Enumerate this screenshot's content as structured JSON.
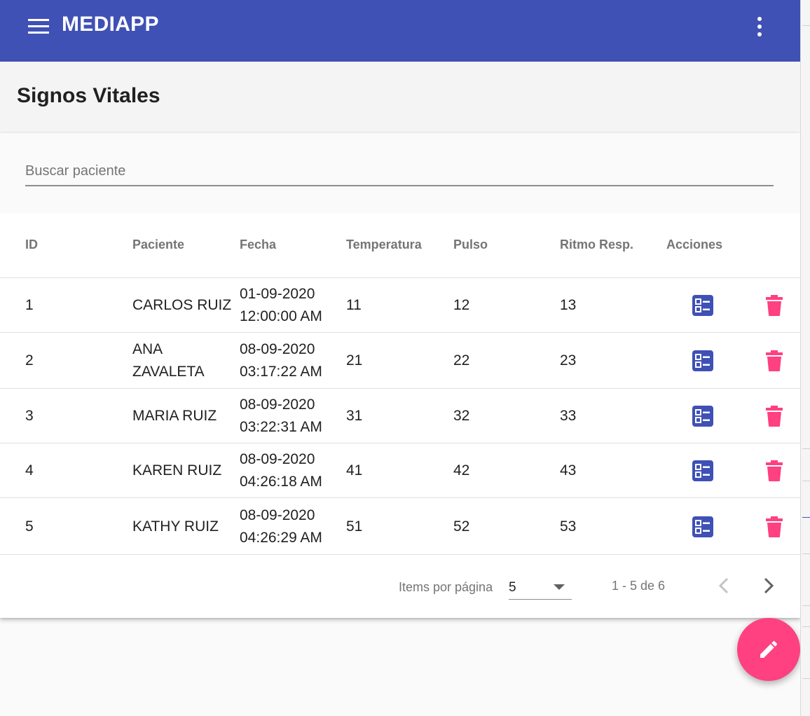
{
  "app": {
    "title": "MEDIAPP",
    "brand_color": "#3f51b5",
    "accent_color": "#ff4081"
  },
  "page": {
    "title": "Signos Vitales"
  },
  "search": {
    "placeholder": "Buscar paciente",
    "value": ""
  },
  "table": {
    "headers": {
      "id": "ID",
      "paciente": "Paciente",
      "fecha": "Fecha",
      "temperatura": "Temperatura",
      "pulso": "Pulso",
      "ritmo": "Ritmo Resp.",
      "acciones": "Acciones"
    },
    "rows": [
      {
        "id": "1",
        "paciente": [
          "CARLOS RUIZ"
        ],
        "fecha": [
          "01-09-2020",
          "12:00:00 AM"
        ],
        "temperatura": "11",
        "pulso": "12",
        "ritmo": "13"
      },
      {
        "id": "2",
        "paciente": [
          "ANA",
          "ZAVALETA"
        ],
        "fecha": [
          "08-09-2020",
          "03:17:22 AM"
        ],
        "temperatura": "21",
        "pulso": "22",
        "ritmo": "23"
      },
      {
        "id": "3",
        "paciente": [
          "MARIA RUIZ"
        ],
        "fecha": [
          "08-09-2020",
          "03:22:31 AM"
        ],
        "temperatura": "31",
        "pulso": "32",
        "ritmo": "33"
      },
      {
        "id": "4",
        "paciente": [
          "KAREN RUIZ"
        ],
        "fecha": [
          "08-09-2020",
          "04:26:18 AM"
        ],
        "temperatura": "41",
        "pulso": "42",
        "ritmo": "43"
      },
      {
        "id": "5",
        "paciente": [
          "KATHY RUIZ"
        ],
        "fecha": [
          "08-09-2020",
          "04:26:29 AM"
        ],
        "temperatura": "51",
        "pulso": "52",
        "ritmo": "53"
      }
    ],
    "action_icons": {
      "edit": "list-detail-icon",
      "delete": "trash-icon"
    }
  },
  "paginator": {
    "label": "Items por página",
    "page_size": "5",
    "range": "1 - 5 de 6",
    "prev_icon": "chevron-left-icon",
    "next_icon": "chevron-right-icon"
  },
  "fab": {
    "icon": "pencil-icon"
  }
}
